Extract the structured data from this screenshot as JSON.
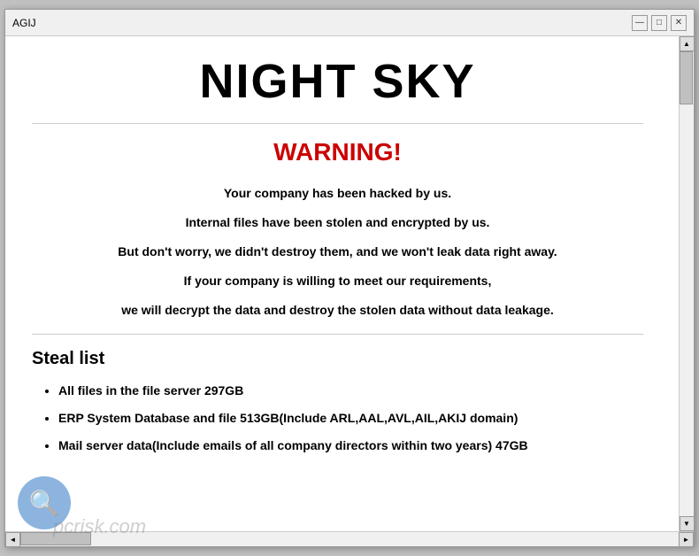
{
  "window": {
    "title": "AGIJ",
    "controls": {
      "minimize": "—",
      "maximize": "□",
      "close": "✕"
    }
  },
  "content": {
    "main_title": "NIGHT SKY",
    "warning_title": "WARNING!",
    "warning_lines": [
      "Your company has been hacked by us.",
      "Internal files have been stolen and encrypted by us.",
      "But don't worry, we didn't destroy them, and we won't leak data right away.",
      "If your company is willing to meet our requirements,",
      "we will decrypt the data and destroy the stolen data without data leakage."
    ],
    "steal_list_title": "Steal list",
    "steal_items": [
      "All files in the file server  297GB",
      "ERP System Database and file  513GB(Include ARL,AAL,AVL,AIL,AKIJ domain)",
      "Mail server data(Include emails of all company directors within two years)  47GB"
    ]
  },
  "watermark": {
    "icon": "🔍",
    "text": "pcrisk.com"
  },
  "scrollbar": {
    "up_arrow": "▲",
    "down_arrow": "▼",
    "left_arrow": "◄",
    "right_arrow": "►"
  }
}
